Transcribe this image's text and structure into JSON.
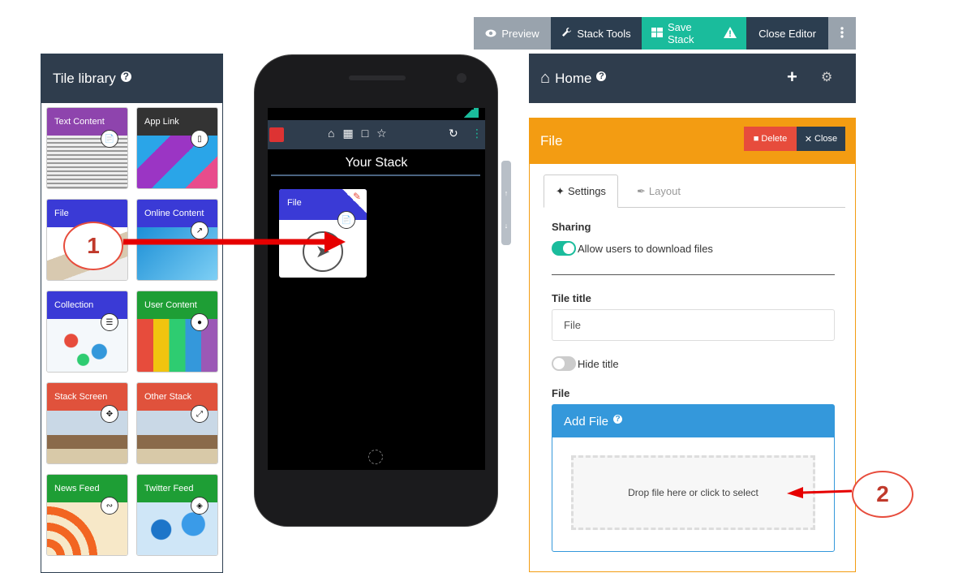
{
  "toolbar": {
    "preview": "Preview",
    "stack_tools": "Stack Tools",
    "save_stack": "Save Stack",
    "close_editor": "Close Editor"
  },
  "library": {
    "title": "Tile library",
    "tiles": [
      {
        "label": "Text Content",
        "color": "#8e44ad"
      },
      {
        "label": "App Link",
        "color": "#333333"
      },
      {
        "label": "File",
        "color": "#3a3ad6"
      },
      {
        "label": "Online Content",
        "color": "#3a3ad6"
      },
      {
        "label": "Collection",
        "color": "#3a3ad6"
      },
      {
        "label": "User Content",
        "color": "#1e9e35"
      },
      {
        "label": "Stack Screen",
        "color": "#e0523c"
      },
      {
        "label": "Other Stack",
        "color": "#e0523c"
      },
      {
        "label": "News Feed",
        "color": "#1e9e35"
      },
      {
        "label": "Twitter Feed",
        "color": "#1e9e35"
      }
    ]
  },
  "phone": {
    "stack_title": "Your Stack",
    "tile_label": "File"
  },
  "home": {
    "title": "Home"
  },
  "file_panel": {
    "title": "File",
    "delete_label": "Delete",
    "close_label": "Close",
    "tabs": {
      "settings": "Settings",
      "layout": "Layout"
    },
    "sharing_label": "Sharing",
    "allow_download": "Allow users to download files",
    "tile_title_label": "Tile title",
    "tile_title_value": "File",
    "hide_title": "Hide title",
    "file_label": "File",
    "add_file": "Add File",
    "drop_text": "Drop file here or click to select"
  },
  "annotations": {
    "one": "1",
    "two": "2"
  }
}
